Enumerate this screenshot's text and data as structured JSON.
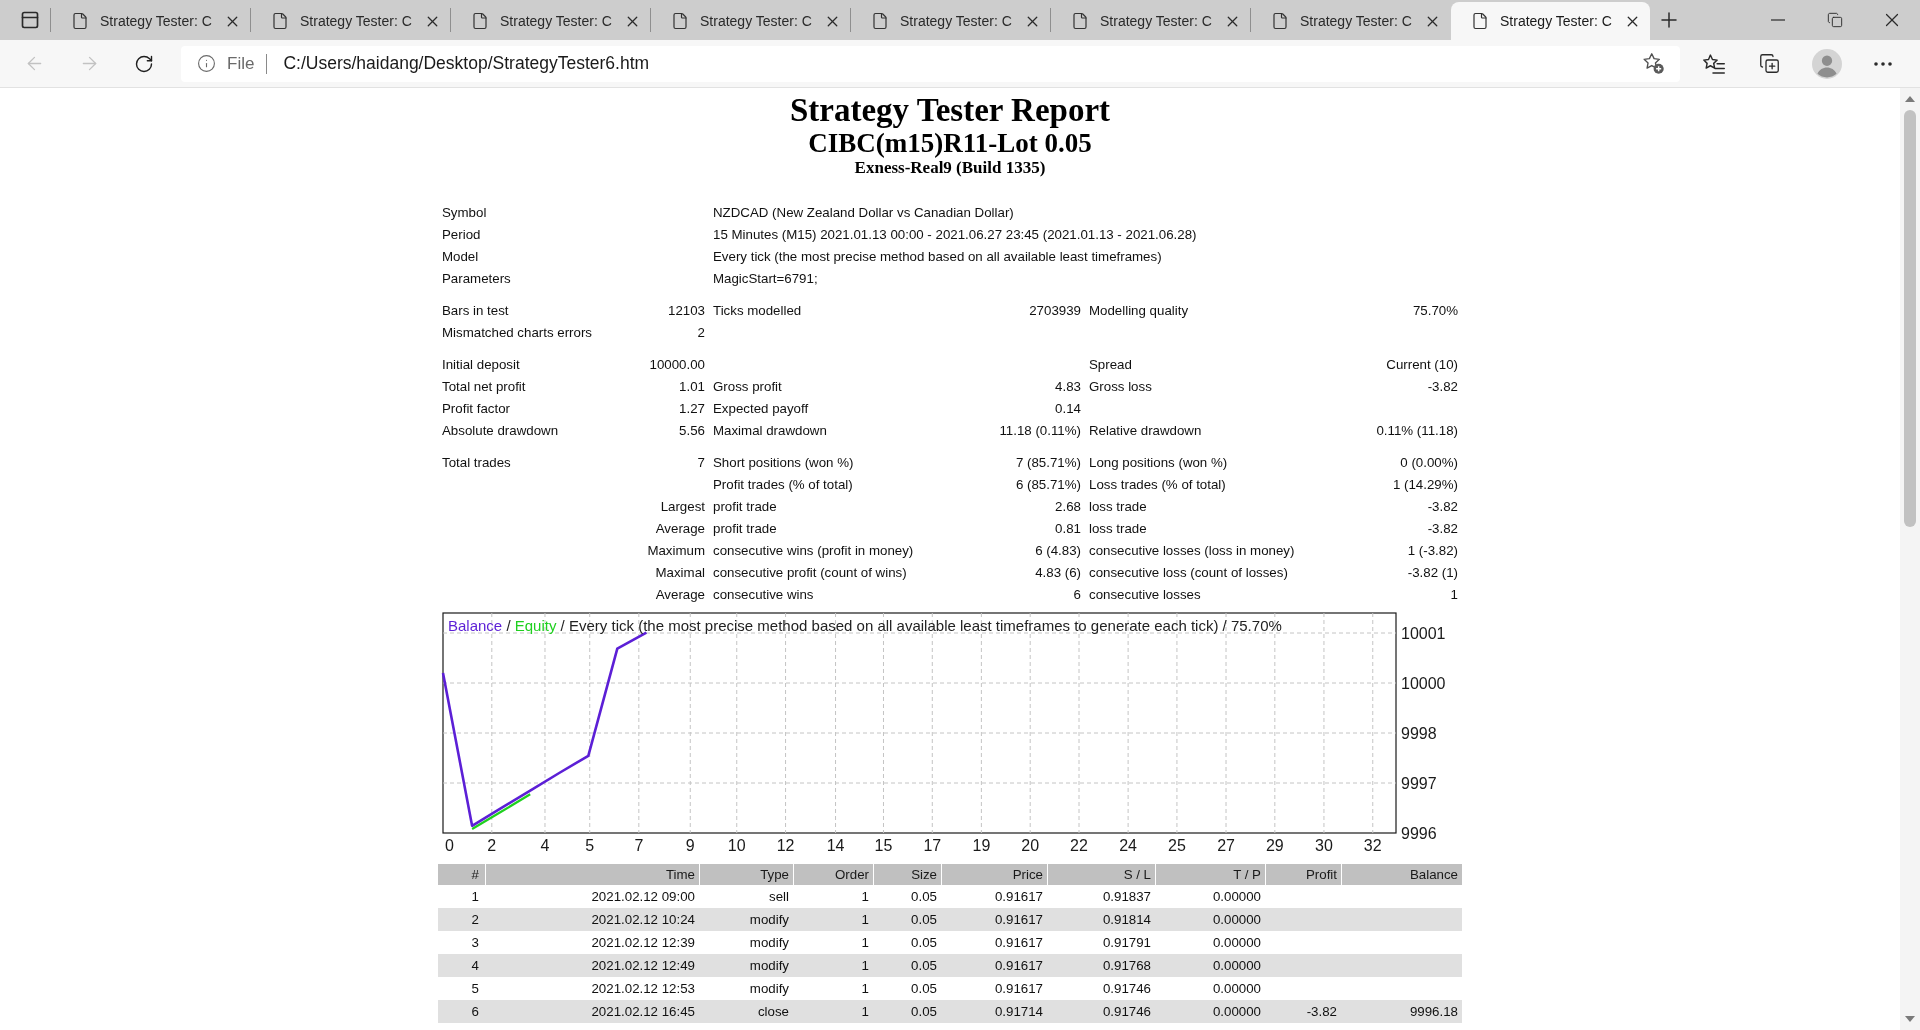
{
  "browser": {
    "tabs": [
      {
        "title": "Strategy Tester: C",
        "selected": false
      },
      {
        "title": "Strategy Tester: C",
        "selected": false
      },
      {
        "title": "Strategy Tester: C",
        "selected": false
      },
      {
        "title": "Strategy Tester: C",
        "selected": false
      },
      {
        "title": "Strategy Tester: C",
        "selected": false
      },
      {
        "title": "Strategy Tester: C",
        "selected": false
      },
      {
        "title": "Strategy Tester: C",
        "selected": false
      },
      {
        "title": "Strategy Tester: C",
        "selected": true
      }
    ],
    "navigation": {
      "back": {
        "disabled": true
      },
      "forward": {
        "disabled": true
      }
    },
    "address_bar": {
      "scheme": "File",
      "url": "C:/Users/haidang/Desktop/StrategyTester6.htm"
    }
  },
  "report": {
    "title": "Strategy Tester Report",
    "subtitle": "CIBC(m15)R11-Lot 0.05",
    "server": "Exness-Real9 (Build 1335)"
  },
  "summary": {
    "groups": [
      {
        "rows": [
          {
            "kind": "info",
            "label": "Symbol",
            "value": "NZDCAD (New Zealand Dollar vs Canadian Dollar)"
          },
          {
            "kind": "info",
            "label": "Period",
            "value": "15 Minutes (M15) 2021.01.13 00:00 - 2021.06.27 23:45 (2021.01.13 - 2021.06.28)"
          },
          {
            "kind": "info",
            "label": "Model",
            "value": "Every tick (the most precise method based on all available least timeframes)"
          },
          {
            "kind": "info",
            "label": "Parameters",
            "value": "MagicStart=6791;"
          }
        ]
      },
      {
        "rows": [
          {
            "kind": "stats",
            "left": {
              "label": "Bars in test",
              "value": "12103"
            },
            "middle": {
              "label": "Ticks modelled",
              "value": "2703939"
            },
            "right": {
              "label": "Modelling quality",
              "value": "75.70%"
            }
          },
          {
            "kind": "stats",
            "left": {
              "label": "Mismatched charts errors",
              "value": "2"
            }
          }
        ]
      },
      {
        "rows": [
          {
            "kind": "stats",
            "left": {
              "label": "Initial deposit",
              "value": "10000.00"
            },
            "right": {
              "label": "Spread",
              "value": "Current (10)"
            }
          },
          {
            "kind": "stats",
            "left": {
              "label": "Total net profit",
              "value": "1.01"
            },
            "middle": {
              "label": "Gross profit",
              "value": "4.83"
            },
            "right": {
              "label": "Gross loss",
              "value": "-3.82"
            }
          },
          {
            "kind": "stats",
            "left": {
              "label": "Profit factor",
              "value": "1.27"
            },
            "middle": {
              "label": "Expected payoff",
              "value": "0.14"
            }
          },
          {
            "kind": "stats",
            "left": {
              "label": "Absolute drawdown",
              "value": "5.56"
            },
            "middle": {
              "label": "Maximal drawdown",
              "value": "11.18 (0.11%)"
            },
            "right": {
              "label": "Relative drawdown",
              "value": "0.11% (11.18)"
            }
          }
        ]
      },
      {
        "rows": [
          {
            "kind": "stats",
            "left": {
              "label": "Total trades",
              "value": "7"
            },
            "middle": {
              "label": "Short positions (won %)",
              "value": "7 (85.71%)"
            },
            "right": {
              "label": "Long positions (won %)",
              "value": "0 (0.00%)"
            }
          },
          {
            "kind": "stats",
            "middle": {
              "label": "Profit trades (% of total)",
              "value": "6 (85.71%)"
            },
            "right": {
              "label": "Loss trades (% of total)",
              "value": "1 (14.29%)"
            }
          },
          {
            "kind": "detail",
            "prefix": "Largest",
            "middle": {
              "label": "profit trade",
              "value": "2.68"
            },
            "right": {
              "label": "loss trade",
              "value": "-3.82"
            }
          },
          {
            "kind": "detail",
            "prefix": "Average",
            "middle": {
              "label": "profit trade",
              "value": "0.81"
            },
            "right": {
              "label": "loss trade",
              "value": "-3.82"
            }
          },
          {
            "kind": "detail",
            "prefix": "Maximum",
            "middle": {
              "label": "consecutive wins (profit in money)",
              "value": "6 (4.83)"
            },
            "right": {
              "label": "consecutive losses (loss in money)",
              "value": "1 (-3.82)"
            }
          },
          {
            "kind": "detail",
            "prefix": "Maximal",
            "middle": {
              "label": "consecutive profit (count of wins)",
              "value": "4.83 (6)"
            },
            "right": {
              "label": "consecutive loss (count of losses)",
              "value": "-3.82 (1)"
            }
          },
          {
            "kind": "detail",
            "prefix": "Average",
            "middle": {
              "label": "consecutive wins",
              "value": "6"
            },
            "right": {
              "label": "consecutive losses",
              "value": "1"
            }
          }
        ]
      }
    ]
  },
  "chart": {
    "legend_separator": "/",
    "chart_data": {
      "type": "line",
      "title": "Every tick (the most precise method based on all available least timeframes to generate each tick) / 75.70%",
      "x": [
        0,
        1,
        2,
        3,
        4,
        5,
        6,
        7
      ],
      "series": [
        {
          "name": "Balance",
          "color": "#5c1fd6",
          "values": [
            10000,
            9996.18,
            9996.62,
            9997.06,
            9997.5,
            9997.93,
            10000.61,
            10001.01
          ]
        },
        {
          "name": "Equity",
          "color": "#1fd01f",
          "values": [
            null,
            9996.1,
            9996.53,
            9996.97,
            null,
            null,
            null,
            null
          ]
        }
      ],
      "xlim": [
        0,
        32.8
      ],
      "ylim": [
        9996,
        10001.5
      ],
      "xticks": [
        0,
        {
          "value": 1.68,
          "label": "2"
        },
        {
          "value": 3.51,
          "label": "4"
        },
        {
          "value": 5.05,
          "label": "5"
        },
        {
          "value": 6.74,
          "label": "7"
        },
        {
          "value": 8.51,
          "label": "9"
        },
        {
          "value": 10.11,
          "label": "10"
        },
        {
          "value": 11.79,
          "label": "12"
        },
        {
          "value": 13.51,
          "label": "14"
        },
        {
          "value": 15.16,
          "label": "15"
        },
        {
          "value": 16.84,
          "label": "17"
        },
        {
          "value": 18.53,
          "label": "19"
        },
        {
          "value": 20.21,
          "label": "20"
        },
        {
          "value": 21.89,
          "label": "22"
        },
        {
          "value": 23.58,
          "label": "24"
        },
        {
          "value": 25.26,
          "label": "25"
        },
        {
          "value": 26.95,
          "label": "27"
        },
        {
          "value": 28.63,
          "label": "29"
        },
        {
          "value": 30.32,
          "label": "30"
        },
        32
      ],
      "yticks": [
        10001,
        {
          "value": 9999.75,
          "label": "10000"
        },
        {
          "value": 9998.5,
          "label": "9998"
        },
        {
          "value": 9997.25,
          "label": "9997"
        },
        9996
      ],
      "grid": true
    }
  },
  "trades": {
    "columns": [
      "#",
      "Time",
      "Type",
      "Order",
      "Size",
      "Price",
      "S / L",
      "T / P",
      "Profit",
      "Balance"
    ],
    "rows": [
      [
        "1",
        "2021.02.12 09:00",
        "sell",
        "1",
        "0.05",
        "0.91617",
        "0.91837",
        "0.00000"
      ],
      [
        "2",
        "2021.02.12 10:24",
        "modify",
        "1",
        "0.05",
        "0.91617",
        "0.91814",
        "0.00000"
      ],
      [
        "3",
        "2021.02.12 12:39",
        "modify",
        "1",
        "0.05",
        "0.91617",
        "0.91791",
        "0.00000"
      ],
      [
        "4",
        "2021.02.12 12:49",
        "modify",
        "1",
        "0.05",
        "0.91617",
        "0.91768",
        "0.00000"
      ],
      [
        "5",
        "2021.02.12 12:53",
        "modify",
        "1",
        "0.05",
        "0.91617",
        "0.91746",
        "0.00000"
      ],
      [
        "6",
        "2021.02.12 16:45",
        "close",
        "1",
        "0.05",
        "0.91714",
        "0.91746",
        "0.00000",
        "-3.82",
        "9996.18"
      ]
    ]
  }
}
